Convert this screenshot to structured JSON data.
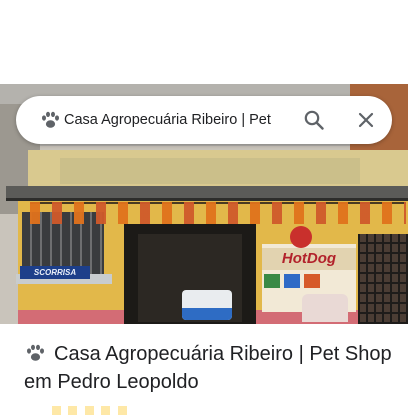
{
  "search": {
    "query": "Casa Agropecuária Ribeiro | Pet",
    "leading_icon": "paw-icon",
    "search_icon": "search-icon",
    "close_icon": "close-icon"
  },
  "photo": {
    "left_sign_text": "SCORRISA",
    "right_sign_text": "HotDog"
  },
  "place": {
    "icon": "paw-icon",
    "title": "Casa Agropecuária Ribeiro | Pet Shop em Pedro Leopoldo"
  },
  "colors": {
    "icon_gray": "#5f6368",
    "text": "#202124",
    "star": "#fbbc04"
  }
}
